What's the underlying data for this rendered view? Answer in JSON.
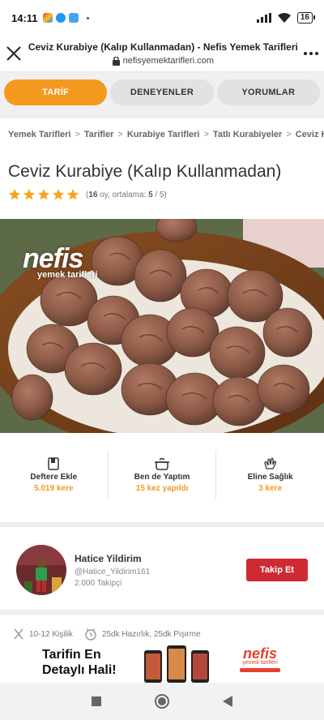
{
  "status_bar": {
    "time": "14:11",
    "battery": "16"
  },
  "browser": {
    "page_title": "Ceviz Kurabiye (Kalıp Kullanmadan) - Nefis Yemek Tarifleri",
    "url": "nefisyemektarifleri.com"
  },
  "tabs": [
    {
      "label": "TARİF"
    },
    {
      "label": "DENEYENLER"
    },
    {
      "label": "YORUMLAR"
    }
  ],
  "breadcrumb": [
    "Yemek Tarifleri",
    "Tarifler",
    "Kurabiye Tarifleri",
    "Tatlı Kurabiyeler",
    "Ceviz Kurab"
  ],
  "breadcrumb_separator": ">",
  "recipe": {
    "title": "Ceviz Kurabiye (Kalıp Kullanmadan)",
    "rating_stars": 5,
    "rating_votes": "16",
    "rating_mid": " oy, ortalama: ",
    "rating_avg": "5",
    "rating_max": " / 5)",
    "rating_open": "("
  },
  "photo": {
    "logo_text": "nefis",
    "logo_sub": "yemek tarifleri"
  },
  "actions": [
    {
      "label": "Deftere Ekle",
      "count": "5.019 kere",
      "icon": "notebook-icon"
    },
    {
      "label": "Ben de Yaptım",
      "count": "15 kez yapıldı",
      "icon": "cooking-pot-icon"
    },
    {
      "label": "Eline Sağlık",
      "count": "3 kere",
      "icon": "clapping-hands-icon"
    }
  ],
  "author": {
    "name": "Hatice Yildirim",
    "handle": "@Hatice_Yildirim161",
    "followers": "2.000 Takipçi",
    "follow_label": "Takip Et"
  },
  "meta": {
    "servings": "10-12 Kişilik",
    "time": "25dk Hazırlık, 25dk Pişirme"
  },
  "ad": {
    "line1": "Tarifin En",
    "line2": "Detaylı Hali!",
    "brand": "nefis",
    "brand_sub": "yemek tarifleri"
  },
  "colors": {
    "accent": "#f39a1e",
    "follow": "#cf2a33"
  }
}
